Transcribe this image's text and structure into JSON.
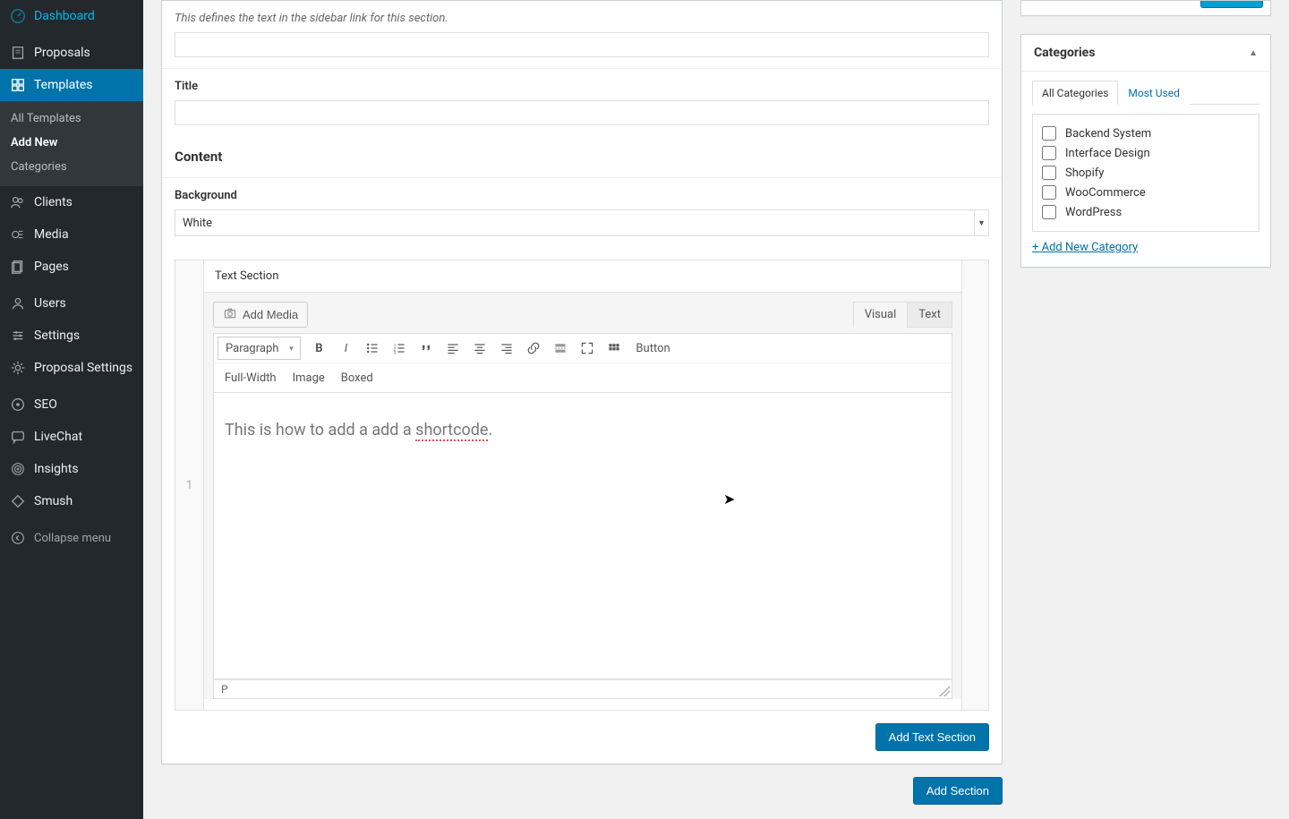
{
  "sidebar": {
    "items": [
      {
        "label": "Dashboard",
        "icon": "dashboard"
      },
      {
        "label": "Proposals",
        "icon": "document"
      },
      {
        "label": "Templates",
        "icon": "grid",
        "active": true
      },
      {
        "label": "Clients",
        "icon": "users"
      },
      {
        "label": "Media",
        "icon": "media"
      },
      {
        "label": "Pages",
        "icon": "pages"
      },
      {
        "label": "Users",
        "icon": "user"
      },
      {
        "label": "Settings",
        "icon": "sliders"
      },
      {
        "label": "Proposal Settings",
        "icon": "gear"
      },
      {
        "label": "SEO",
        "icon": "seo"
      },
      {
        "label": "LiveChat",
        "icon": "chat"
      },
      {
        "label": "Insights",
        "icon": "insights"
      },
      {
        "label": "Smush",
        "icon": "smush"
      }
    ],
    "submenu": [
      {
        "label": "All Templates"
      },
      {
        "label": "Add New",
        "current": true
      },
      {
        "label": "Categories"
      }
    ],
    "collapse_label": "Collapse menu"
  },
  "form": {
    "sidebar_hint": "This defines the text in the sidebar link for this section.",
    "sidebar_value": "",
    "title_label": "Title",
    "title_value": "",
    "content_heading": "Content",
    "background_label": "Background",
    "background_value": "White",
    "text_section_title": "Text Section",
    "row_index": "1",
    "add_media_label": "Add Media",
    "tabs": {
      "visual": "Visual",
      "text": "Text"
    },
    "format_select": "Paragraph",
    "toolbar_row2": {
      "full_width": "Full-Width",
      "image": "Image",
      "boxed": "Boxed"
    },
    "button_tool": "Button",
    "editor_text_a": "This is how to add a add a ",
    "editor_text_b": "shortcode",
    "editor_text_c": ".",
    "status_path": "P",
    "add_text_section": "Add Text Section",
    "add_section": "Add Section"
  },
  "categories_panel": {
    "title": "Categories",
    "tabs": {
      "all": "All Categories",
      "most": "Most Used"
    },
    "items": [
      "Backend System",
      "Interface Design",
      "Shopify",
      "WooCommerce",
      "WordPress"
    ],
    "add_new_link": "+ Add New Category"
  }
}
